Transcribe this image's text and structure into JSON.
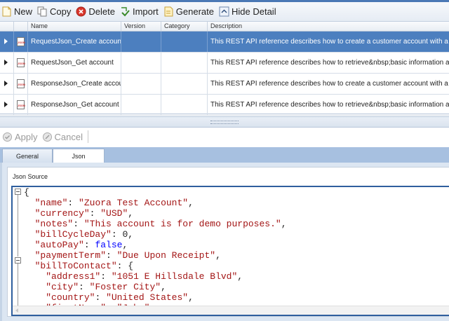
{
  "toolbar": {
    "new_label": "New",
    "copy_label": "Copy",
    "delete_label": "Delete",
    "import_label": "Import",
    "generate_label": "Generate",
    "hide_detail_label": "Hide Detail"
  },
  "grid": {
    "columns": [
      "Name",
      "Version",
      "Category",
      "Description"
    ],
    "rows": [
      {
        "name": "RequestJson_Create account",
        "version": "",
        "category": "",
        "description": "This REST API reference describes how to create a customer account with a credit-card payment method, a bill-to contact, and an optional sold-to contact",
        "selected": true
      },
      {
        "name": "RequestJson_Get account",
        "version": "",
        "category": "",
        "description": "This REST API reference describes how to retrieve&nbsp;basic information about a customer account",
        "selected": false
      },
      {
        "name": "ResponseJson_Create account",
        "version": "",
        "category": "",
        "description": "This REST API reference describes how to create a customer account with a credit-card payment method, a bill-to contact, and an optional sold-to contact",
        "selected": false
      },
      {
        "name": "ResponseJson_Get account",
        "version": "",
        "category": "",
        "description": "This REST API reference describes how to retrieve&nbsp;basic information about a customer account",
        "selected": false
      }
    ]
  },
  "actions": {
    "apply_label": "Apply",
    "cancel_label": "Cancel"
  },
  "tabs": [
    {
      "label": "General",
      "active": false
    },
    {
      "label": "Json",
      "active": true
    }
  ],
  "json_group": {
    "label": "Json Source"
  },
  "json_source": [
    "{",
    "  \"name\": \"Zuora Test Account\",",
    "  \"currency\": \"USD\",",
    "  \"notes\": \"This account is for demo purposes.\",",
    "  \"billCycleDay\": 0,",
    "  \"autoPay\": false,",
    "  \"paymentTerm\": \"Due Upon Receipt\",",
    "  \"billToContact\": {",
    "    \"address1\": \"1051 E Hillsdale Blvd\",",
    "    \"city\": \"Foster City\",",
    "    \"country\": \"United States\",",
    "    \"firstName\": \"John\","
  ],
  "colors": {
    "selection": "#4c7fbf",
    "json_string": "#a31515",
    "json_keyword": "#0000ff",
    "editor_border": "#2f5f9e"
  }
}
